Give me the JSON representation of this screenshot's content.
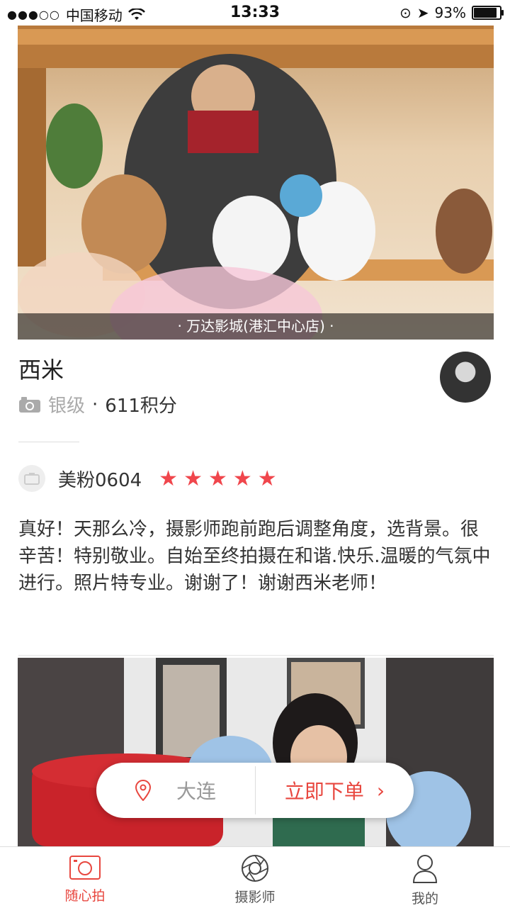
{
  "status_bar": {
    "carrier": "中国移动",
    "time": "13:33",
    "battery": "93%",
    "battery_level": 0.93
  },
  "card1": {
    "location": "· 万达影城(港汇中心店) ·",
    "photographer_name": "西米",
    "level": "银级",
    "separator": "·",
    "points": "611积分"
  },
  "review": {
    "reviewer": "美粉0604",
    "rating": 5,
    "text": "真好！天那么冷，摄影师跑前跑后调整角度，选背景。很辛苦！特别敬业。自始至终拍摄在和谐.快乐.温暖的气氛中进行。照片特专业。谢谢了！谢谢西米老师！"
  },
  "float_bar": {
    "city": "大连",
    "order_label": "立即下单",
    "order_arrow": "›"
  },
  "tabs": [
    {
      "label": "随心拍",
      "icon": "camera-icon",
      "active": true
    },
    {
      "label": "摄影师",
      "icon": "aperture-icon",
      "active": false
    },
    {
      "label": "我的",
      "icon": "user-icon",
      "active": false
    }
  ],
  "colors": {
    "accent": "#e8473f",
    "star": "#f0464c"
  }
}
